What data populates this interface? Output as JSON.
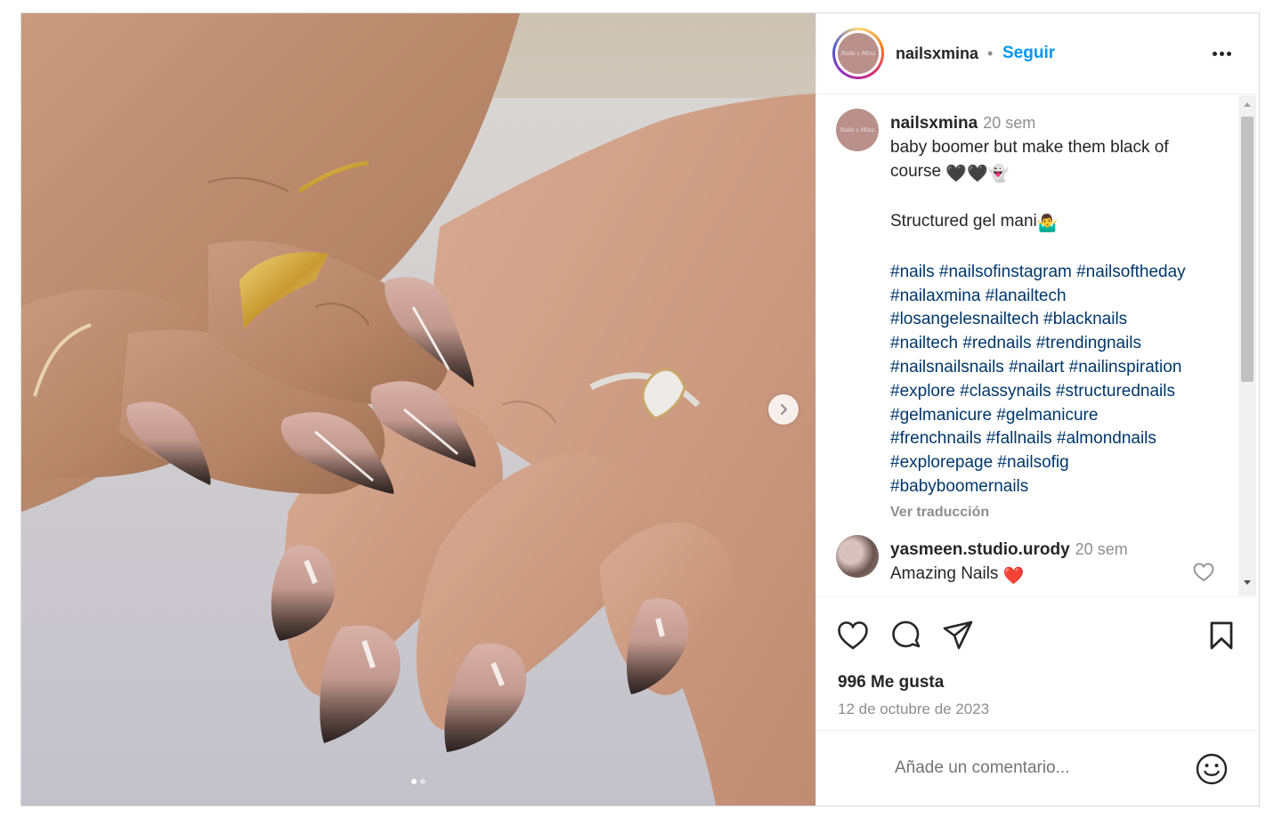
{
  "media": {
    "next_icon": "chevron-right-icon",
    "carousel": {
      "count": 2,
      "active": 0
    }
  },
  "header": {
    "avatar_text": "Nails x Mina",
    "username": "nailsxmina",
    "separator": "•",
    "follow_label": "Seguir",
    "more_icon": "more-options-icon"
  },
  "caption": {
    "avatar_text": "Nails x Mina",
    "username": "nailsxmina",
    "time": "20 sem",
    "text_line1": "baby boomer but make them black of",
    "text_line2": "course",
    "text_line2_emojis": "🖤🖤👻",
    "structured": "Structured gel mani",
    "structured_emoji": "🤷‍♂️",
    "hashtag_lines": [
      "#nails #nailsofinstagram #nailsoftheday",
      "#nailaxmina #lanailtech",
      "#losangelesnailtech #blacknails",
      "#nailtech #rednails #trendingnails",
      "#nailsnailsnails #nailart #nailinspiration",
      "#explore #classynails #structurednails",
      "#gelmanicure #gelmanicure",
      "#frenchnails #fallnails #almondnails",
      "#explorepage #nailsofig",
      "#babyboomernails"
    ],
    "translate_label": "Ver traducción"
  },
  "comments": [
    {
      "username": "yasmeen.studio.urody",
      "time": "20 sem",
      "text": "Amazing Nails",
      "emoji": "❤️"
    }
  ],
  "actions": {
    "like_icon": "heart-icon",
    "comment_icon": "comment-icon",
    "share_icon": "share-icon",
    "save_icon": "bookmark-icon",
    "likes_text": "996 Me gusta",
    "date": "12 de octubre de 2023"
  },
  "add_comment": {
    "placeholder": "Añade un comentario...",
    "emoji_icon": "smiley-icon"
  },
  "colors": {
    "accent": "#0095f6",
    "hashtag": "#00376b",
    "muted": "#8e8e8e",
    "text": "#262626",
    "like_red": "#ed4956"
  }
}
